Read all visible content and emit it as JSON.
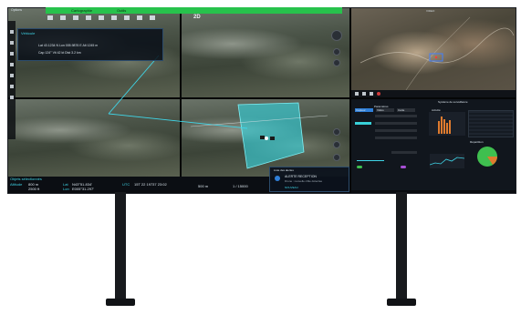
{
  "scene": {
    "description_free": true
  },
  "left_screen": {
    "menu": {
      "label": "Options",
      "active_tab": "Cartographie",
      "tab_2": "Outils"
    },
    "zoom_label": "2D",
    "info_panel": {
      "title": "Véhicule",
      "rows": [
        "Lat 43.1234 N  Lon 005.9876 E  Alt 1245 m",
        "Cap 124°  Vit 42 kt  Dist 3.2 km"
      ]
    },
    "status_bar": {
      "title": "Objets sélectionnés",
      "altitude_label": "Altitude",
      "altitude_value": "800 m",
      "altitude_value2": "2500 ft",
      "lat_label": "Lat",
      "lat_value": "N43°51.834'",
      "lon_label": "Lon",
      "lon_value": "E005°31.297'",
      "utc_label": "UTC",
      "utc_value": "15T 22 19737 23:02",
      "scale": "500 m",
      "ratio": "1 / 15000"
    },
    "notification": {
      "header": "Liste des alertes",
      "title": "ALERTE RECEPTION",
      "body": "Drone : nouvelle cible détectée",
      "footer": "NOUVEAU"
    }
  },
  "right_screen": {
    "video_title": "VIDEO",
    "dashboard_title": "Système de surveillance",
    "left_panel_title": "Paramètres",
    "tabs": [
      "Capteur",
      "Vidéo",
      "Carte"
    ],
    "bars_title": "Activité",
    "pie_title": "Répartition"
  },
  "colors": {
    "toolbar_green": "#27c24c",
    "zone_cyan": "#38d0d8",
    "accent_blue": "#2f7fd8",
    "pie_green": "#3fbf4f",
    "pie_orange": "#e07b2e"
  }
}
